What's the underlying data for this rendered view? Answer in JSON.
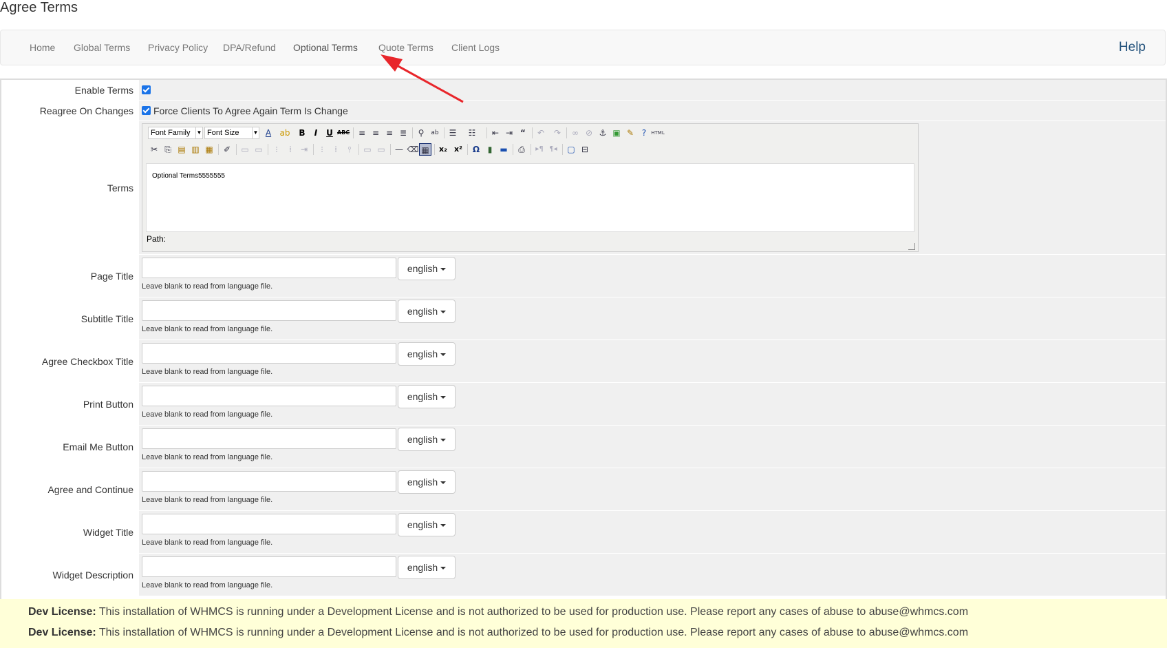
{
  "page": {
    "title": "Agree Terms"
  },
  "nav": {
    "tabs": [
      {
        "label": "Home"
      },
      {
        "label": "Global Terms"
      },
      {
        "label": "Privacy Policy"
      },
      {
        "label": "DPA/Refund"
      },
      {
        "label": "Optional Terms"
      },
      {
        "label": "Quote Terms"
      },
      {
        "label": "Client Logs"
      }
    ],
    "active_tab": "Optional Terms",
    "help_label": "Help"
  },
  "form": {
    "enable_terms": {
      "label": "Enable Terms",
      "checked": true
    },
    "reagree": {
      "label": "Reagree On Changes",
      "checked": true,
      "checkbox_label": "Force Clients To Agree Again Term Is Change"
    },
    "terms": {
      "label": "Terms",
      "font_family_placeholder": "Font Family",
      "font_size_placeholder": "Font Size",
      "content": "Optional Terms5555555",
      "path_label": "Path:"
    },
    "help_text": "Leave blank to read from language file.",
    "language_button": "english",
    "text_fields": [
      {
        "label": "Page Title",
        "value": ""
      },
      {
        "label": "Subtitle Title",
        "value": ""
      },
      {
        "label": "Agree Checkbox Title",
        "value": ""
      },
      {
        "label": "Print Button",
        "value": ""
      },
      {
        "label": "Email Me Button",
        "value": ""
      },
      {
        "label": "Agree and Continue",
        "value": ""
      },
      {
        "label": "Widget Title",
        "value": ""
      },
      {
        "label": "Widget Description",
        "value": ""
      }
    ]
  },
  "license": {
    "lines": [
      {
        "prefix": "Dev License:",
        "text": " This installation of WHMCS is running under a Development License and is not authorized to be used for production use. Please report any cases of abuse to abuse@whmcs.com"
      },
      {
        "prefix": "Dev License:",
        "text": " This installation of WHMCS is running under a Development License and is not authorized to be used for production use. Please report any cases of abuse to abuse@whmcs.com"
      }
    ]
  },
  "colors": {
    "accent": "#23527c",
    "checkbox": "#1a73e8",
    "annotation_arrow": "#e8262b",
    "license_bg": "#ffffd8"
  },
  "toolbar": {
    "row1_icons": [
      "font-color-icon",
      "highlight-color-icon",
      "bold-icon",
      "italic-icon",
      "underline-icon",
      "strikethrough-icon",
      "align-left-icon",
      "align-center-icon",
      "align-right-icon",
      "align-justify-icon",
      "find-icon",
      "replace-icon",
      "bullet-list-icon",
      "numbered-list-icon",
      "outdent-icon",
      "indent-icon",
      "blockquote-icon",
      "undo-icon",
      "redo-icon",
      "link-icon",
      "unlink-icon",
      "anchor-icon",
      "image-icon",
      "cleanup-icon",
      "help-icon",
      "html-icon"
    ],
    "row2_icons": [
      "cut-icon",
      "copy-icon",
      "paste-icon",
      "paste-text-icon",
      "paste-word-icon",
      "edit-icon",
      "table-icon",
      "table-props-icon",
      "row-props-icon",
      "insert-row-icon",
      "delete-row-icon",
      "col-icon",
      "split-icon",
      "merge-icon",
      "layer-icon",
      "layer-props-icon",
      "hr-icon",
      "eraser-icon",
      "visual-aid-icon",
      "subscript-icon",
      "superscript-icon",
      "charmap-icon",
      "media-icon",
      "advhr-icon",
      "print-icon",
      "ltr-icon",
      "rtl-icon",
      "fullscreen-icon",
      "pagebreak-icon"
    ]
  }
}
